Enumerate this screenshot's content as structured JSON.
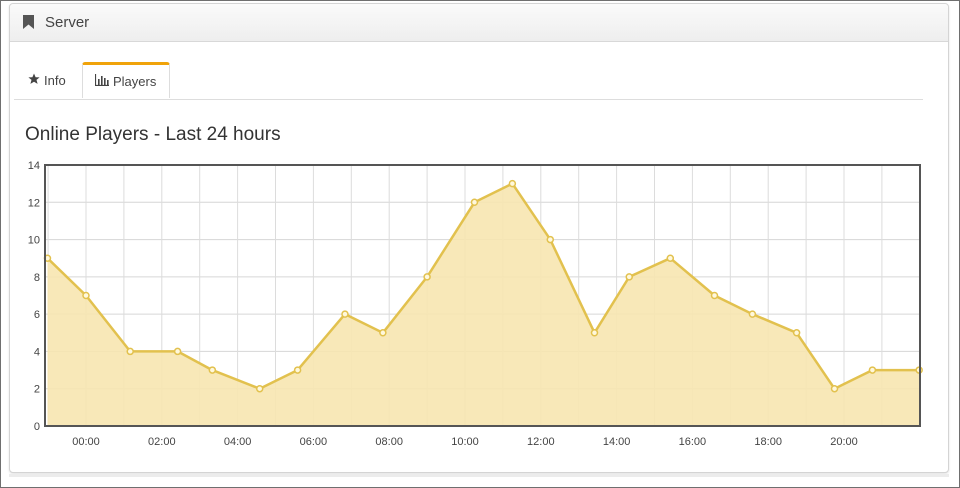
{
  "panel": {
    "title": "Server",
    "icon": "bookmark-icon"
  },
  "tabs": [
    {
      "label": "Info",
      "icon": "star-icon",
      "active": false
    },
    {
      "label": "Players",
      "icon": "bar-chart-icon",
      "active": true
    }
  ],
  "colors": {
    "active_tab_accent": "#f0a30a",
    "series_line": "#e2c14e",
    "series_fill": "#f7e6b0"
  },
  "chart_data": {
    "type": "area",
    "title": "Online Players - Last 24 hours",
    "xlabel": "",
    "ylabel": "",
    "ylim": [
      0,
      14
    ],
    "y_ticks": [
      "0",
      "2",
      "4",
      "6",
      "8",
      "10",
      "12",
      "14"
    ],
    "x_ticks": [
      "00:00",
      "02:00",
      "04:00",
      "06:00",
      "08:00",
      "10:00",
      "12:00",
      "14:00",
      "16:00",
      "18:00",
      "20:00"
    ],
    "grid": true,
    "series": [
      {
        "x": [
          "22:59",
          "00:00",
          "01:10",
          "02:25",
          "03:20",
          "04:35",
          "05:35",
          "06:50",
          "07:50",
          "09:00",
          "10:15",
          "11:15",
          "12:15",
          "13:25",
          "14:20",
          "15:25",
          "16:35",
          "17:35",
          "18:45",
          "19:45",
          "20:45",
          "21:59"
        ],
        "values": [
          9,
          7,
          4,
          4,
          3,
          2,
          3,
          6,
          5,
          8,
          12,
          13,
          10,
          5,
          8,
          9,
          7,
          6,
          5,
          2,
          3,
          3
        ]
      }
    ]
  }
}
